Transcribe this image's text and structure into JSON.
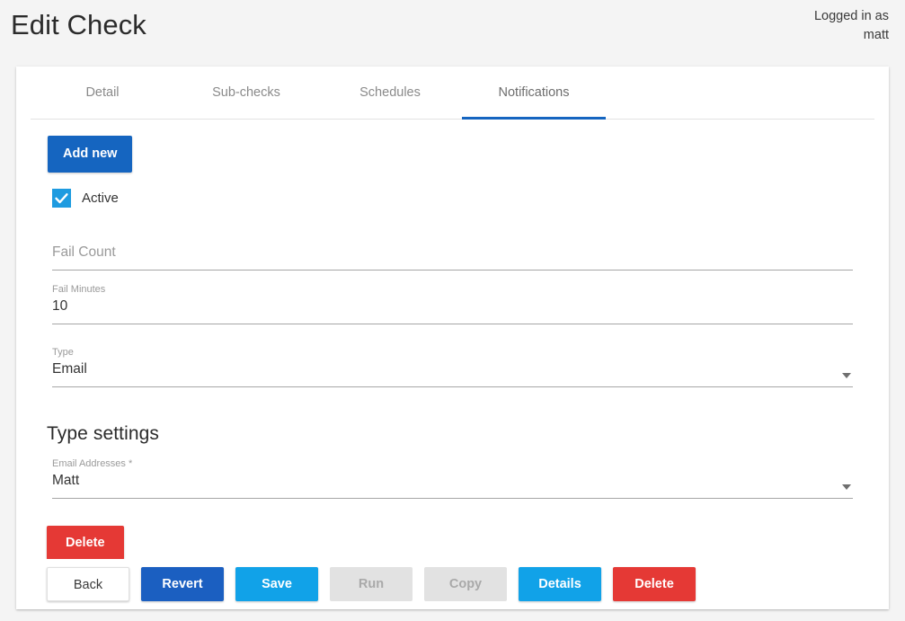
{
  "header": {
    "title": "Edit Check",
    "login_status_line1": "Logged in as",
    "login_status_line2": "matt"
  },
  "tabs": [
    {
      "label": "Detail",
      "active": false
    },
    {
      "label": "Sub-checks",
      "active": false
    },
    {
      "label": "Schedules",
      "active": false
    },
    {
      "label": "Notifications",
      "active": true
    }
  ],
  "toolbar": {
    "add_new_label": "Add new"
  },
  "active_checkbox": {
    "label": "Active",
    "checked": true
  },
  "fields": {
    "fail_count": {
      "label": "Fail Count",
      "placeholder": "Fail Count",
      "value": ""
    },
    "fail_minutes": {
      "label": "Fail Minutes",
      "value": "10"
    },
    "type": {
      "label": "Type",
      "value": "Email"
    }
  },
  "type_settings": {
    "heading": "Type settings",
    "email_addresses": {
      "label": "Email Addresses *",
      "value": "Matt"
    },
    "delete_label": "Delete"
  },
  "footer": {
    "back_label": "Back",
    "revert_label": "Revert",
    "save_label": "Save",
    "run_label": "Run",
    "copy_label": "Copy",
    "details_label": "Details",
    "delete_label": "Delete"
  },
  "colors": {
    "page_background": "#f4f4f4",
    "primary_dark_blue": "#1565c0",
    "accent_blue": "#11a2e8",
    "danger_red": "#e53935",
    "disabled_gray": "#e2e2e2",
    "tab_underline": "#1565c0"
  }
}
